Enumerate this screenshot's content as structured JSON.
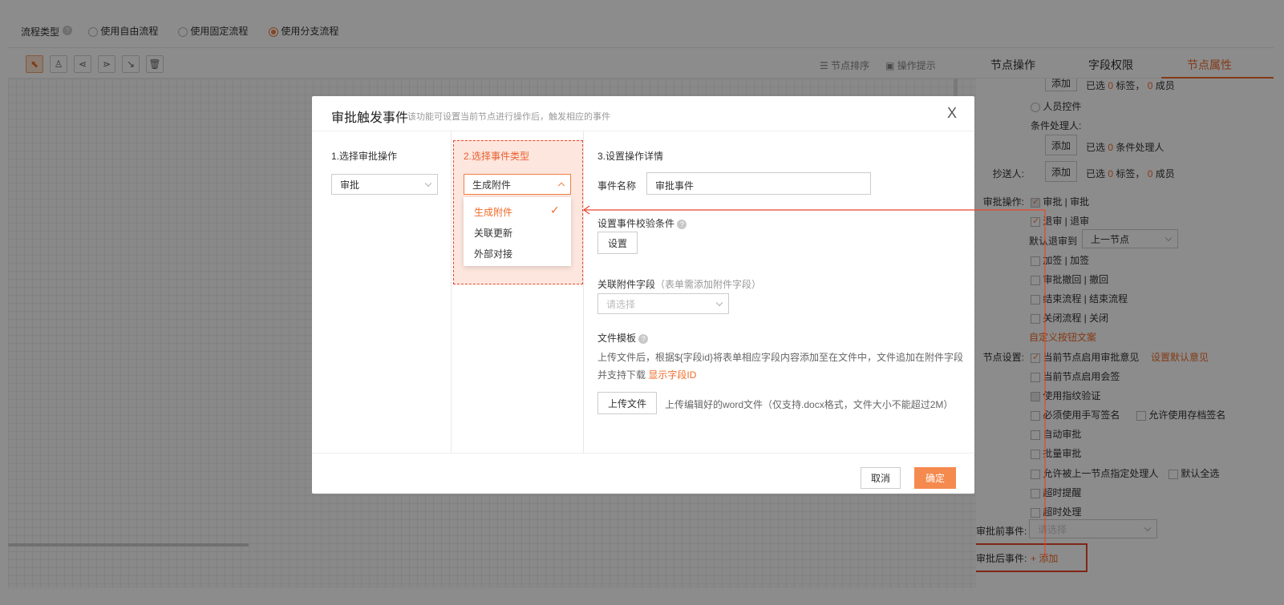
{
  "topbar": {
    "label": "流程类型",
    "options": [
      "使用自由流程",
      "使用固定流程",
      "使用分支流程"
    ],
    "selected": 2
  },
  "toolbar": {
    "node_sort": "节点排序",
    "op_hint": "操作提示"
  },
  "right_panel": {
    "tabs": [
      "节点操作",
      "字段权限",
      "节点属性"
    ],
    "active_tab": 2,
    "add": "添加",
    "selected_tags_prefix": "已选",
    "selected_tags_num": "0",
    "tags_suffix": "标签，",
    "members_num": "0",
    "members_suffix": "成员",
    "person_control": "人员控件",
    "cond_handler_label": "条件处理人:",
    "cond_handler_prefix": "已选",
    "cond_handler_num": "0",
    "cond_handler_suffix": "条件处理人",
    "cc_label": "抄送人:",
    "approve_ops_label": "审批操作:",
    "ops": [
      {
        "label": "审批 | 审批",
        "state": "dis"
      },
      {
        "label": "退审 | 退审",
        "state": "on"
      }
    ],
    "default_return_label": "默认退审到",
    "default_return_value": "上一节点",
    "ops2": [
      "加签 | 加签",
      "审批撤回 | 撤回",
      "结束流程 | 结束流程",
      "关闭流程 | 关闭"
    ],
    "custom_btn_text": "自定义按钮文案",
    "node_settings_label": "节点设置:",
    "enable_opinion": "当前节点启用审批意见",
    "set_default_opinion": "设置默认意见",
    "settings": [
      "当前节点启用会签",
      "使用指纹验证",
      "必须使用手写签名",
      "自动审批",
      "批量审批",
      "允许被上一节点指定处理人",
      "超时提醒",
      "超时处理"
    ],
    "allow_archive_sign": "允许使用存档签名",
    "default_select_all": "默认全选",
    "before_event_label": "审批前事件:",
    "before_event_placeholder": "请选择",
    "after_event_label": "审批后事件:",
    "after_event_add": "+ 添加"
  },
  "modal": {
    "title": "审批触发事件",
    "subtitle": "该功能可设置当前节点进行操作后，触发相应的事件",
    "close": "X",
    "col1": {
      "heading": "1.选择审批操作",
      "value": "审批"
    },
    "col2": {
      "heading": "2.选择事件类型",
      "value": "生成附件",
      "options": [
        "生成附件",
        "关联更新",
        "外部对接"
      ]
    },
    "col3": {
      "heading": "3.设置操作详情",
      "event_name_label": "事件名称",
      "event_name_value": "审批事件",
      "check_cond_label": "设置事件校验条件",
      "set_btn": "设置",
      "attach_field_label": "关联附件字段",
      "attach_field_hint": "（表单需添加附件字段）",
      "attach_field_placeholder": "请选择",
      "file_tpl_label": "文件模板",
      "file_tpl_desc1": "上传文件后，根据${字段id}将表单相应字段内容添加至在文件中，文件追加在附件字段",
      "file_tpl_desc2": "并支持下载",
      "show_field_id": "显示字段ID",
      "upload_btn": "上传文件",
      "upload_hint": "上传编辑好的word文件（仅支持.docx格式，文件大小不能超过2M）"
    },
    "cancel": "取消",
    "confirm": "确定"
  },
  "colors": {
    "accent": "#f06b2a",
    "highlight_box": "#e8452a"
  }
}
